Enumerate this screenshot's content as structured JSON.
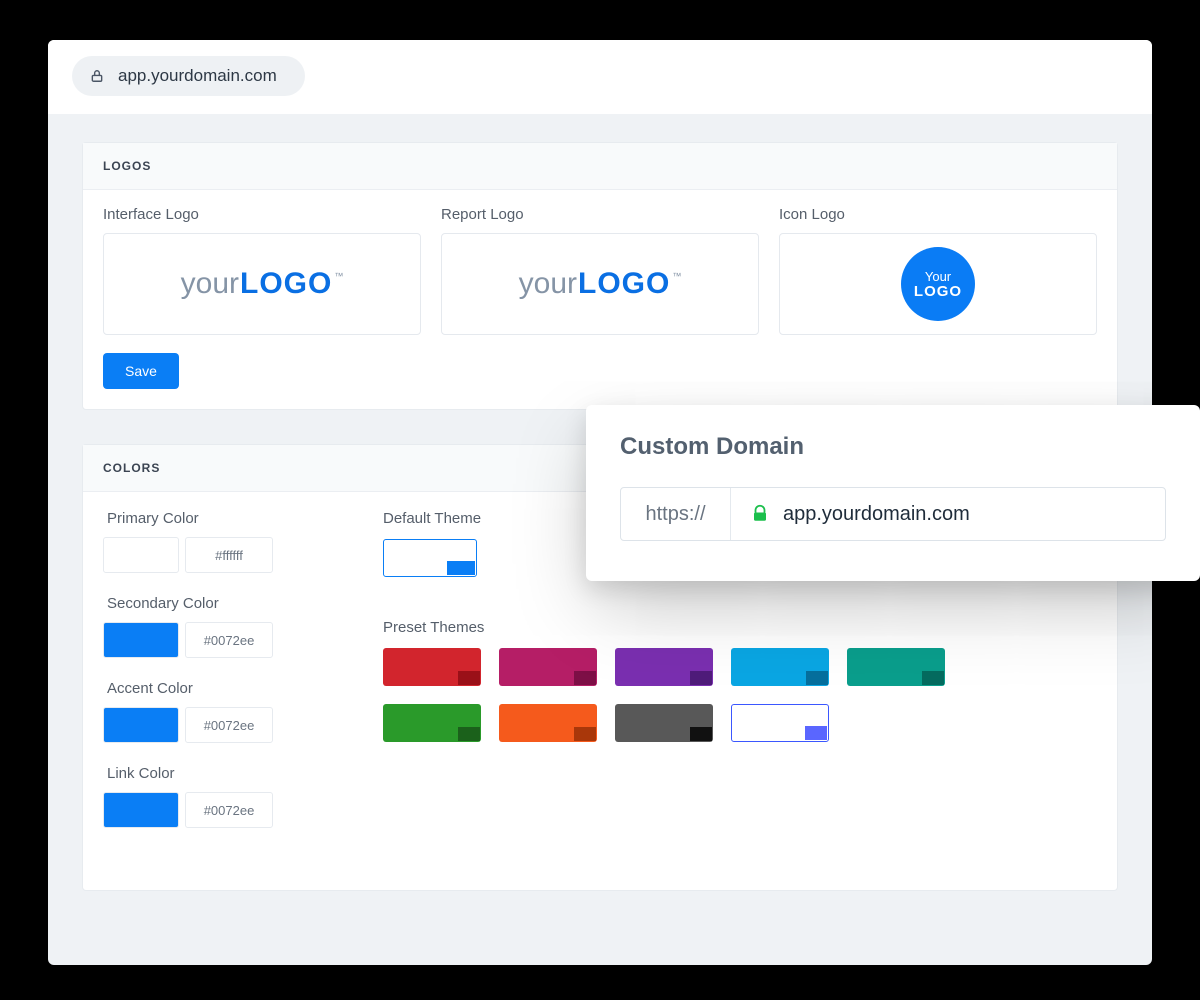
{
  "browser": {
    "url": "app.yourdomain.com"
  },
  "logos_panel": {
    "heading": "LOGOS",
    "interface_label": "Interface Logo",
    "report_label": "Report Logo",
    "icon_label": "Icon Logo",
    "wordmark_light": "your",
    "wordmark_bold": "LOGO",
    "wordmark_tm": "™",
    "circle_line1": "Your",
    "circle_line2": "LOGO",
    "save_label": "Save"
  },
  "colors_panel": {
    "heading": "COLORS",
    "fields": {
      "primary": {
        "label": "Primary Color",
        "swatch": "#ffffff",
        "hex": "#ffffff"
      },
      "secondary": {
        "label": "Secondary Color",
        "swatch": "#0a7ef5",
        "hex": "#0072ee"
      },
      "accent": {
        "label": "Accent Color",
        "swatch": "#0a7ef5",
        "hex": "#0072ee"
      },
      "link": {
        "label": "Link Color",
        "swatch": "#0a7ef5",
        "hex": "#0072ee"
      }
    },
    "default_theme_label": "Default Theme",
    "preset_themes_label": "Preset Themes",
    "preset_themes": [
      {
        "bg": "#d2252d",
        "patch": "#9a1018"
      },
      {
        "bg": "#b51e66",
        "patch": "#7d0f46"
      },
      {
        "bg": "#7a2fb0",
        "patch": "#4f1c7a"
      },
      {
        "bg": "#0aa6e3",
        "patch": "#066f9d"
      },
      {
        "bg": "#0a9e8c",
        "patch": "#056b5f"
      },
      {
        "bg": "#2a9a2a",
        "patch": "#1b611b"
      },
      {
        "bg": "#f55a1c",
        "patch": "#a9370a"
      },
      {
        "bg": "#585858",
        "patch": "#111111"
      },
      {
        "bg": "#ffffff",
        "patch": "#5a66ff",
        "outlined": true
      }
    ]
  },
  "domain_card": {
    "title": "Custom Domain",
    "prefix": "https://",
    "value": "app.yourdomain.com"
  }
}
